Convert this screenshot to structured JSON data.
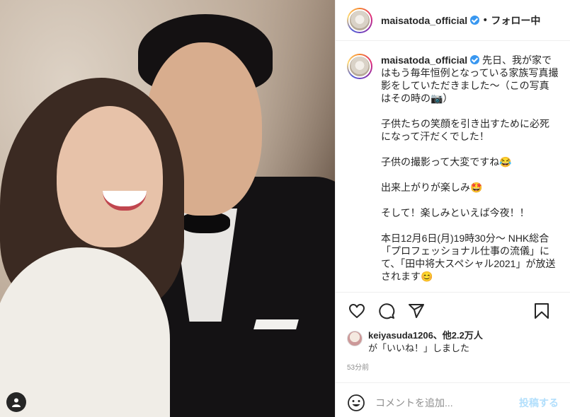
{
  "header": {
    "username": "maisatoda_official",
    "separator": "•",
    "follow_label": "フォロー中"
  },
  "caption": {
    "username": "maisatoda_official",
    "paragraphs": [
      "先日、我が家ではもう毎年恒例となっている家族写真撮影をしていただきました〜（この写真はその時の📷）",
      "子供たちの笑顔を引き出すために必死になって汗だくでした！",
      "子供の撮影って大変ですね😂",
      "出来上がりが楽しみ🤩",
      "そして！楽しみといえば今夜！！",
      "本日12月6日(月)19時30分〜 NHK総合「プロフェッショナル仕事の流儀」にて、「田中将大スペシャル2021」が放送されます😊"
    ]
  },
  "likes": {
    "liker": "keiyasuda1206",
    "others": "、他2.2万人",
    "suffix": "が「いいね！」しました"
  },
  "time_ago": "53分前",
  "comment": {
    "placeholder": "コメントを追加...",
    "post_label": "投稿する"
  },
  "icons": {
    "like": "heart-icon",
    "comment": "comment-icon",
    "share": "share-icon",
    "save": "bookmark-icon",
    "emoji": "smiley-icon",
    "user": "user-icon"
  }
}
